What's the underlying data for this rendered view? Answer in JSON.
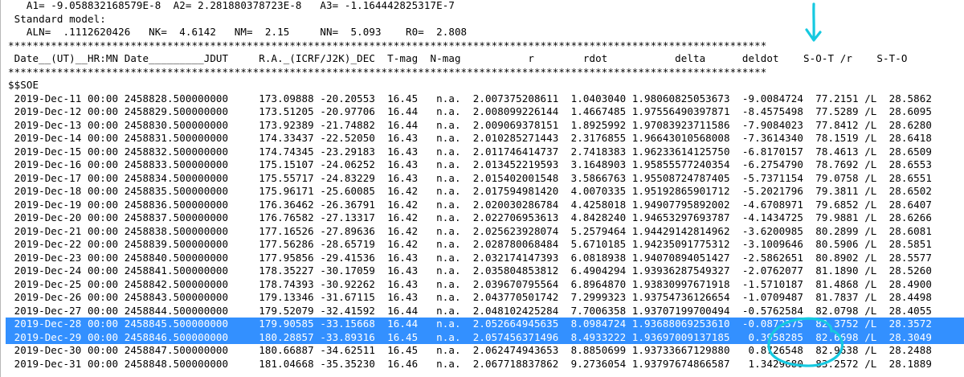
{
  "header": {
    "coeff_line": "   A1= -9.058832168579E-8  A2= 2.281880378723E-8   A3= -1.164442825317E-7",
    "model_label": " Standard model:",
    "model_line": "   ALN=  .1112620426   NK=  4.6142   NM=  2.15     NN=  5.093    R0=  2.808",
    "separator": "****************************************************************************************************************************",
    "columns": " Date__(UT)__HR:MN Date_________JDUT     R.A._(ICRF/J2K)_DEC  T-mag  N-mag           r        rdot           delta      deldot    S-O-T /r    S-T-O",
    "separator2": "****************************************************************************************************************************",
    "soe": "$$SOE"
  },
  "rows": [
    {
      "date": "2019-Dec-11 00:00",
      "jdut": "2458828.500000000",
      "ra": "173.09888",
      "dec": "-20.20553",
      "tmag": "16.45",
      "nmag": "n.a.",
      "r": "2.007375208611",
      "rdot": "1.0403040",
      "delta": "1.98060825053673",
      "deldot": "-9.0084724",
      "sot": "77.2151",
      "r_flag": "/L",
      "sto": "28.5862"
    },
    {
      "date": "2019-Dec-12 00:00",
      "jdut": "2458829.500000000",
      "ra": "173.51205",
      "dec": "-20.97706",
      "tmag": "16.44",
      "nmag": "n.a.",
      "r": "2.008099226144",
      "rdot": "1.4667485",
      "delta": "1.97556490397871",
      "deldot": "-8.4575498",
      "sot": "77.5289",
      "r_flag": "/L",
      "sto": "28.6095"
    },
    {
      "date": "2019-Dec-13 00:00",
      "jdut": "2458830.500000000",
      "ra": "173.92389",
      "dec": "-21.74882",
      "tmag": "16.44",
      "nmag": "n.a.",
      "r": "2.009069378151",
      "rdot": "1.8925992",
      "delta": "1.97083923711586",
      "deldot": "-7.9084023",
      "sot": "77.8412",
      "r_flag": "/L",
      "sto": "28.6280"
    },
    {
      "date": "2019-Dec-14 00:00",
      "jdut": "2458831.500000000",
      "ra": "174.33437",
      "dec": "-22.52050",
      "tmag": "16.43",
      "nmag": "n.a.",
      "r": "2.010285271443",
      "rdot": "2.3176855",
      "delta": "1.96643010568008",
      "deldot": "-7.3614340",
      "sot": "78.1519",
      "r_flag": "/L",
      "sto": "28.6418"
    },
    {
      "date": "2019-Dec-15 00:00",
      "jdut": "2458832.500000000",
      "ra": "174.74345",
      "dec": "-23.29183",
      "tmag": "16.43",
      "nmag": "n.a.",
      "r": "2.011746414737",
      "rdot": "2.7418383",
      "delta": "1.96233614125750",
      "deldot": "-6.8170157",
      "sot": "78.4613",
      "r_flag": "/L",
      "sto": "28.6509"
    },
    {
      "date": "2019-Dec-16 00:00",
      "jdut": "2458833.500000000",
      "ra": "175.15107",
      "dec": "-24.06252",
      "tmag": "16.43",
      "nmag": "n.a.",
      "r": "2.013452219593",
      "rdot": "3.1648903",
      "delta": "1.95855577240354",
      "deldot": "-6.2754790",
      "sot": "78.7692",
      "r_flag": "/L",
      "sto": "28.6553"
    },
    {
      "date": "2019-Dec-17 00:00",
      "jdut": "2458834.500000000",
      "ra": "175.55717",
      "dec": "-24.83229",
      "tmag": "16.43",
      "nmag": "n.a.",
      "r": "2.015402001548",
      "rdot": "3.5866763",
      "delta": "1.95508724787405",
      "deldot": "-5.7371154",
      "sot": "79.0758",
      "r_flag": "/L",
      "sto": "28.6551"
    },
    {
      "date": "2019-Dec-18 00:00",
      "jdut": "2458835.500000000",
      "ra": "175.96171",
      "dec": "-25.60085",
      "tmag": "16.42",
      "nmag": "n.a.",
      "r": "2.017594981420",
      "rdot": "4.0070335",
      "delta": "1.95192865901712",
      "deldot": "-5.2021796",
      "sot": "79.3811",
      "r_flag": "/L",
      "sto": "28.6502"
    },
    {
      "date": "2019-Dec-19 00:00",
      "jdut": "2458836.500000000",
      "ra": "176.36462",
      "dec": "-26.36791",
      "tmag": "16.42",
      "nmag": "n.a.",
      "r": "2.020030286784",
      "rdot": "4.4258018",
      "delta": "1.94907795892002",
      "deldot": "-4.6708971",
      "sot": "79.6852",
      "r_flag": "/L",
      "sto": "28.6407"
    },
    {
      "date": "2019-Dec-20 00:00",
      "jdut": "2458837.500000000",
      "ra": "176.76582",
      "dec": "-27.13317",
      "tmag": "16.42",
      "nmag": "n.a.",
      "r": "2.022706953613",
      "rdot": "4.8428240",
      "delta": "1.94653297693787",
      "deldot": "-4.1434725",
      "sot": "79.9881",
      "r_flag": "/L",
      "sto": "28.6266"
    },
    {
      "date": "2019-Dec-21 00:00",
      "jdut": "2458838.500000000",
      "ra": "177.16526",
      "dec": "-27.89636",
      "tmag": "16.42",
      "nmag": "n.a.",
      "r": "2.025623928074",
      "rdot": "5.2579464",
      "delta": "1.94429142814962",
      "deldot": "-3.6200985",
      "sot": "80.2899",
      "r_flag": "/L",
      "sto": "28.6081"
    },
    {
      "date": "2019-Dec-22 00:00",
      "jdut": "2458839.500000000",
      "ra": "177.56286",
      "dec": "-28.65719",
      "tmag": "16.42",
      "nmag": "n.a.",
      "r": "2.028780068484",
      "rdot": "5.6710185",
      "delta": "1.94235091775312",
      "deldot": "-3.1009646",
      "sot": "80.5906",
      "r_flag": "/L",
      "sto": "28.5851"
    },
    {
      "date": "2019-Dec-23 00:00",
      "jdut": "2458840.500000000",
      "ra": "177.95856",
      "dec": "-29.41536",
      "tmag": "16.43",
      "nmag": "n.a.",
      "r": "2.032174147393",
      "rdot": "6.0818938",
      "delta": "1.94070894051427",
      "deldot": "-2.5862651",
      "sot": "80.8902",
      "r_flag": "/L",
      "sto": "28.5577"
    },
    {
      "date": "2019-Dec-24 00:00",
      "jdut": "2458841.500000000",
      "ra": "178.35227",
      "dec": "-30.17059",
      "tmag": "16.43",
      "nmag": "n.a.",
      "r": "2.035804853812",
      "rdot": "6.4904294",
      "delta": "1.93936287549327",
      "deldot": "-2.0762077",
      "sot": "81.1890",
      "r_flag": "/L",
      "sto": "28.5260"
    },
    {
      "date": "2019-Dec-25 00:00",
      "jdut": "2458842.500000000",
      "ra": "178.74393",
      "dec": "-30.92262",
      "tmag": "16.43",
      "nmag": "n.a.",
      "r": "2.039670795564",
      "rdot": "6.8964870",
      "delta": "1.93830997671918",
      "deldot": "-1.5710187",
      "sot": "81.4868",
      "r_flag": "/L",
      "sto": "28.4900"
    },
    {
      "date": "2019-Dec-26 00:00",
      "jdut": "2458843.500000000",
      "ra": "179.13346",
      "dec": "-31.67115",
      "tmag": "16.43",
      "nmag": "n.a.",
      "r": "2.043770501742",
      "rdot": "7.2999323",
      "delta": "1.93754736126654",
      "deldot": "-1.0709487",
      "sot": "81.7837",
      "r_flag": "/L",
      "sto": "28.4498"
    },
    {
      "date": "2019-Dec-27 00:00",
      "jdut": "2458844.500000000",
      "ra": "179.52079",
      "dec": "-32.41592",
      "tmag": "16.44",
      "nmag": "n.a.",
      "r": "2.048102425284",
      "rdot": "7.7006358",
      "delta": "1.93707199700494",
      "deldot": "-0.5762584",
      "sot": "82.0798",
      "r_flag": "/L",
      "sto": "28.4055"
    },
    {
      "date": "2019-Dec-28 00:00",
      "jdut": "2458845.500000000",
      "ra": "179.90585",
      "dec": "-33.15668",
      "tmag": "16.44",
      "nmag": "n.a.",
      "r": "2.052664945635",
      "rdot": "8.0984724",
      "delta": "1.93688069253610",
      "deldot": "-0.0872375",
      "sot": "82.3752",
      "r_flag": "/L",
      "sto": "28.3572"
    },
    {
      "date": "2019-Dec-29 00:00",
      "jdut": "2458846.500000000",
      "ra": "180.28857",
      "dec": "-33.89316",
      "tmag": "16.45",
      "nmag": "n.a.",
      "r": "2.057456371496",
      "rdot": "8.4933222",
      "delta": "1.93697009137185",
      "deldot": "0.3958285",
      "sot": "82.6698",
      "r_flag": "/L",
      "sto": "28.3049"
    },
    {
      "date": "2019-Dec-30 00:00",
      "jdut": "2458847.500000000",
      "ra": "180.66887",
      "dec": "-34.62511",
      "tmag": "16.45",
      "nmag": "n.a.",
      "r": "2.062474943653",
      "rdot": "8.8850699",
      "delta": "1.93733667129880",
      "deldot": "0.8726548",
      "sot": "82.9638",
      "r_flag": "/L",
      "sto": "28.2488"
    },
    {
      "date": "2019-Dec-31 00:00",
      "jdut": "2458848.500000000",
      "ra": "181.04668",
      "dec": "-35.35230",
      "tmag": "16.46",
      "nmag": "n.a.",
      "r": "2.067718837862",
      "rdot": "9.2736054",
      "delta": "1.93797674866587",
      "deldot": "1.3429680",
      "sot": "83.2572",
      "r_flag": "/L",
      "sto": "28.1889"
    }
  ],
  "selection": {
    "rows": [
      "2019-Dec-28 00:00",
      "2019-Dec-29 00:00"
    ],
    "color": "#3390ff"
  },
  "annotation": {
    "color": "#16c9e0",
    "arrow_target": "deldot",
    "circled_values": [
      "-0.0872375",
      "0.3958285"
    ]
  }
}
